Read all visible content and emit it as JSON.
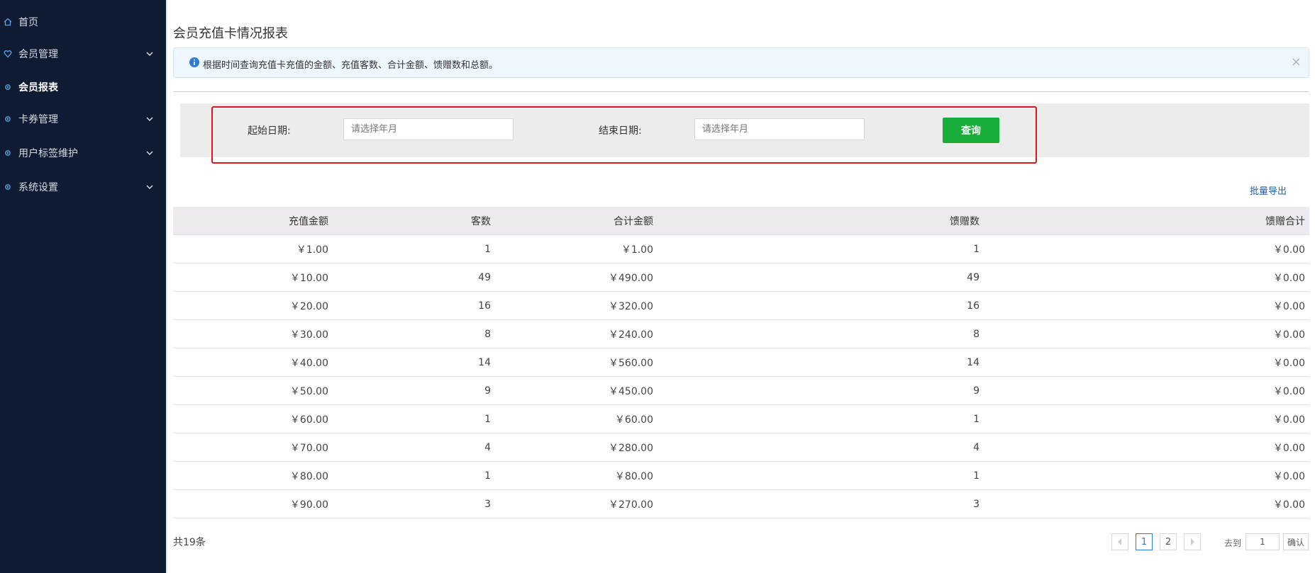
{
  "sidebar": {
    "items": [
      {
        "label": "首页",
        "icon": "home-icon",
        "expandable": false,
        "active": false
      },
      {
        "label": "会员管理",
        "icon": "heart-icon",
        "expandable": true,
        "active": false
      },
      {
        "label": "会员报表",
        "icon": "gear-icon",
        "expandable": false,
        "active": true
      },
      {
        "label": "卡券管理",
        "icon": "gear-icon",
        "expandable": true,
        "active": false
      },
      {
        "label": "用户标签维护",
        "icon": "gear-icon",
        "expandable": true,
        "active": false
      },
      {
        "label": "系统设置",
        "icon": "gear-icon",
        "expandable": true,
        "active": false
      }
    ]
  },
  "page": {
    "title": "会员充值卡情况报表"
  },
  "alert": {
    "text": "根据时间查询充值卡充值的金额、充值客数、合计金额、馈赠数和总额。",
    "close": "×"
  },
  "filter": {
    "start_label": "起始日期:",
    "start_placeholder": "请选择年月",
    "end_label": "结束日期:",
    "end_placeholder": "请选择年月",
    "query_button": "查询"
  },
  "export_label": "批量导出",
  "table": {
    "headers": [
      "充值金额",
      "客数",
      "合计金额",
      "馈赠数",
      "馈赠合计"
    ],
    "rows": [
      [
        "￥1.00",
        "1",
        "￥1.00",
        "1",
        "￥0.00"
      ],
      [
        "￥10.00",
        "49",
        "￥490.00",
        "49",
        "￥0.00"
      ],
      [
        "￥20.00",
        "16",
        "￥320.00",
        "16",
        "￥0.00"
      ],
      [
        "￥30.00",
        "8",
        "￥240.00",
        "8",
        "￥0.00"
      ],
      [
        "￥40.00",
        "14",
        "￥560.00",
        "14",
        "￥0.00"
      ],
      [
        "￥50.00",
        "9",
        "￥450.00",
        "9",
        "￥0.00"
      ],
      [
        "￥60.00",
        "1",
        "￥60.00",
        "1",
        "￥0.00"
      ],
      [
        "￥70.00",
        "4",
        "￥280.00",
        "4",
        "￥0.00"
      ],
      [
        "￥80.00",
        "1",
        "￥80.00",
        "1",
        "￥0.00"
      ],
      [
        "￥90.00",
        "3",
        "￥270.00",
        "3",
        "￥0.00"
      ]
    ]
  },
  "pagination": {
    "total": "共19条",
    "pages": [
      "1",
      "2"
    ],
    "current": "1",
    "goto_label": "去到",
    "goto_value": "1",
    "confirm": "确认"
  },
  "colors": {
    "sidebar_bg": "#0f1b33",
    "accent_green": "#1aad3c",
    "highlight_red": "#e0151b",
    "link_blue": "#1f5fa8"
  }
}
